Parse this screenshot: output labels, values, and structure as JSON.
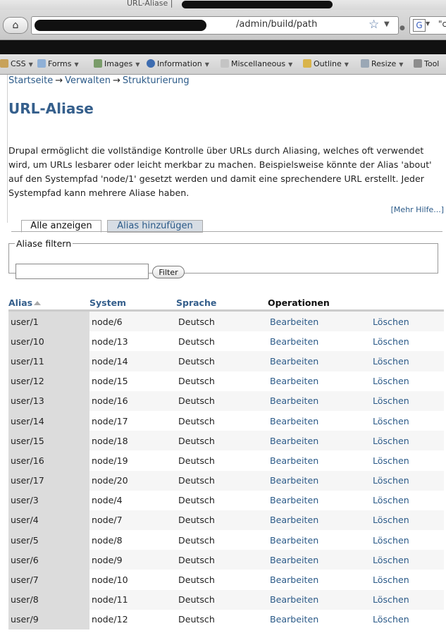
{
  "browser": {
    "window_title": "URL-Aliase |",
    "url_visible": "/admin/build/path",
    "search_text": "\"c"
  },
  "devbar": {
    "items": [
      "CSS",
      "Forms",
      "Images",
      "Information",
      "Miscellaneous",
      "Outline",
      "Resize",
      "Tool"
    ]
  },
  "breadcrumb": {
    "items": [
      "Startseite",
      "Verwalten",
      "Strukturierung"
    ],
    "separator": "→"
  },
  "page": {
    "title": "URL-Aliase",
    "intro": "Drupal ermöglicht die vollständige Kontrolle über URLs durch Aliasing, welches oft verwendet wird, um URLs lesbarer oder leicht merkbar zu machen. Beispielsweise könnte der Alias 'about' auf den Systempfad 'node/1' gesetzt werden und damit eine sprechendere URL erstellt. Jeder Systempfad kann mehrere Aliase haben.",
    "more_help": "[Mehr Hilfe...]"
  },
  "tabs": {
    "active": "Alle anzeigen",
    "other": "Alias hinzufügen"
  },
  "filter": {
    "legend": "Aliase filtern",
    "value": "",
    "button": "Filter"
  },
  "table": {
    "headers": {
      "alias": "Alias",
      "system": "System",
      "language": "Sprache",
      "operations": "Operationen"
    },
    "edit_label": "Bearbeiten",
    "delete_label": "Löschen",
    "rows": [
      {
        "alias": "user/1",
        "system": "node/6",
        "language": "Deutsch"
      },
      {
        "alias": "user/10",
        "system": "node/13",
        "language": "Deutsch"
      },
      {
        "alias": "user/11",
        "system": "node/14",
        "language": "Deutsch"
      },
      {
        "alias": "user/12",
        "system": "node/15",
        "language": "Deutsch"
      },
      {
        "alias": "user/13",
        "system": "node/16",
        "language": "Deutsch"
      },
      {
        "alias": "user/14",
        "system": "node/17",
        "language": "Deutsch"
      },
      {
        "alias": "user/15",
        "system": "node/18",
        "language": "Deutsch"
      },
      {
        "alias": "user/16",
        "system": "node/19",
        "language": "Deutsch"
      },
      {
        "alias": "user/17",
        "system": "node/20",
        "language": "Deutsch"
      },
      {
        "alias": "user/3",
        "system": "node/4",
        "language": "Deutsch"
      },
      {
        "alias": "user/4",
        "system": "node/7",
        "language": "Deutsch"
      },
      {
        "alias": "user/5",
        "system": "node/8",
        "language": "Deutsch"
      },
      {
        "alias": "user/6",
        "system": "node/9",
        "language": "Deutsch"
      },
      {
        "alias": "user/7",
        "system": "node/10",
        "language": "Deutsch"
      },
      {
        "alias": "user/8",
        "system": "node/11",
        "language": "Deutsch"
      },
      {
        "alias": "user/9",
        "system": "node/12",
        "language": "Deutsch"
      }
    ]
  },
  "colors": {
    "link": "#2b5a88",
    "title": "#355f8c",
    "alias_column_bg": "#dcdcdc"
  }
}
